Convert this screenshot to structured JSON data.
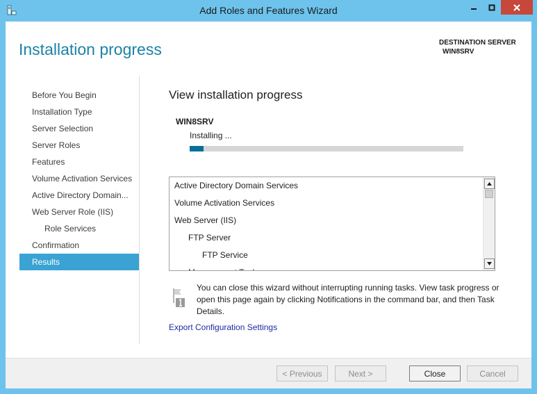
{
  "window": {
    "title": "Add Roles and Features Wizard",
    "accent_color": "#6ec3ec",
    "close_color": "#c7473a"
  },
  "header": {
    "page_title": "Installation progress",
    "destination_label": "DESTINATION SERVER",
    "destination_server": "WIN8SRV"
  },
  "sidebar": {
    "items": [
      {
        "label": "Before You Begin"
      },
      {
        "label": "Installation Type"
      },
      {
        "label": "Server Selection"
      },
      {
        "label": "Server Roles"
      },
      {
        "label": "Features"
      },
      {
        "label": "Volume Activation Services"
      },
      {
        "label": "Active Directory Domain..."
      },
      {
        "label": "Web Server Role (IIS)"
      },
      {
        "label": "Role Services"
      },
      {
        "label": "Confirmation"
      },
      {
        "label": "Results"
      }
    ],
    "active_index": 10
  },
  "main": {
    "heading": "View installation progress",
    "server_name": "WIN8SRV",
    "status": "Installing ...",
    "progress_fraction": 0.05,
    "features": [
      {
        "label": "Active Directory Domain Services",
        "level": 0
      },
      {
        "label": "Volume Activation Services",
        "level": 0
      },
      {
        "label": "Web Server (IIS)",
        "level": 0
      },
      {
        "label": "FTP Server",
        "level": 1
      },
      {
        "label": "FTP Service",
        "level": 2
      },
      {
        "label": "Management Tools",
        "level": 1
      }
    ],
    "note": "You can close this wizard without interrupting running tasks. View task progress or open this page again by clicking Notifications in the command bar, and then Task Details.",
    "export_link": "Export Configuration Settings"
  },
  "footer": {
    "previous_label": "< Previous",
    "next_label": "Next >",
    "close_label": "Close",
    "cancel_label": "Cancel"
  }
}
